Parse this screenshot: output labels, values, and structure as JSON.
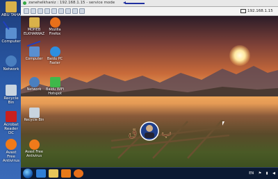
{
  "host": {
    "icons": [
      {
        "label": "ABU TAHA",
        "icon": "user-folder-icon",
        "color": "#d9b24a"
      },
      {
        "label": "Computer",
        "icon": "computer-icon",
        "color": "#5a8fd0"
      },
      {
        "label": "Network",
        "icon": "network-icon",
        "color": "#4a7fc0"
      },
      {
        "label": "Recycle Bin",
        "icon": "recycle-bin-icon",
        "color": "#c8d4e0"
      },
      {
        "label": "Acrobat Reader DC",
        "icon": "acrobat-icon",
        "color": "#c8201e"
      },
      {
        "label": "Avast Free Antivirus",
        "icon": "avast-icon",
        "color": "#f07a1a"
      }
    ]
  },
  "viewer": {
    "title": "zanehelkhaniz : 192.168.1.15 - service mode",
    "address": "192.168.1.15"
  },
  "remote": {
    "icons": [
      {
        "label": "MOHEB ELKHARRAZ",
        "icon": "user-folder-icon",
        "color": "#d9b24a"
      },
      {
        "label": "Mozilla Firefox",
        "icon": "firefox-icon",
        "color": "#e8701a"
      },
      {
        "label": "Computer",
        "icon": "computer-icon",
        "color": "#5a8fd0"
      },
      {
        "label": "Baidu PC Faster",
        "icon": "baidu-icon",
        "color": "#2d8fe0"
      },
      {
        "label": "Network",
        "icon": "network-icon",
        "color": "#4a7fc0"
      },
      {
        "label": "Baidu WiFi Hotspot",
        "icon": "wifi-hotspot-icon",
        "color": "#3fb84a"
      },
      {
        "label": "Recycle Bin",
        "icon": "recycle-bin-icon",
        "color": "#c8d4e0"
      },
      {
        "label": "Avast Free Antivirus",
        "icon": "avast-icon",
        "color": "#f07a1a"
      }
    ],
    "watermark_text": "ق ل ب",
    "taskbar": {
      "apps": [
        {
          "icon": "ie-icon",
          "color": "#2f7fd8"
        },
        {
          "icon": "explorer-icon",
          "color": "#e6c65a"
        },
        {
          "icon": "media-player-icon",
          "color": "#e67a1a"
        },
        {
          "icon": "firefox-icon",
          "color": "#e8701a"
        }
      ],
      "language": "EN"
    }
  }
}
